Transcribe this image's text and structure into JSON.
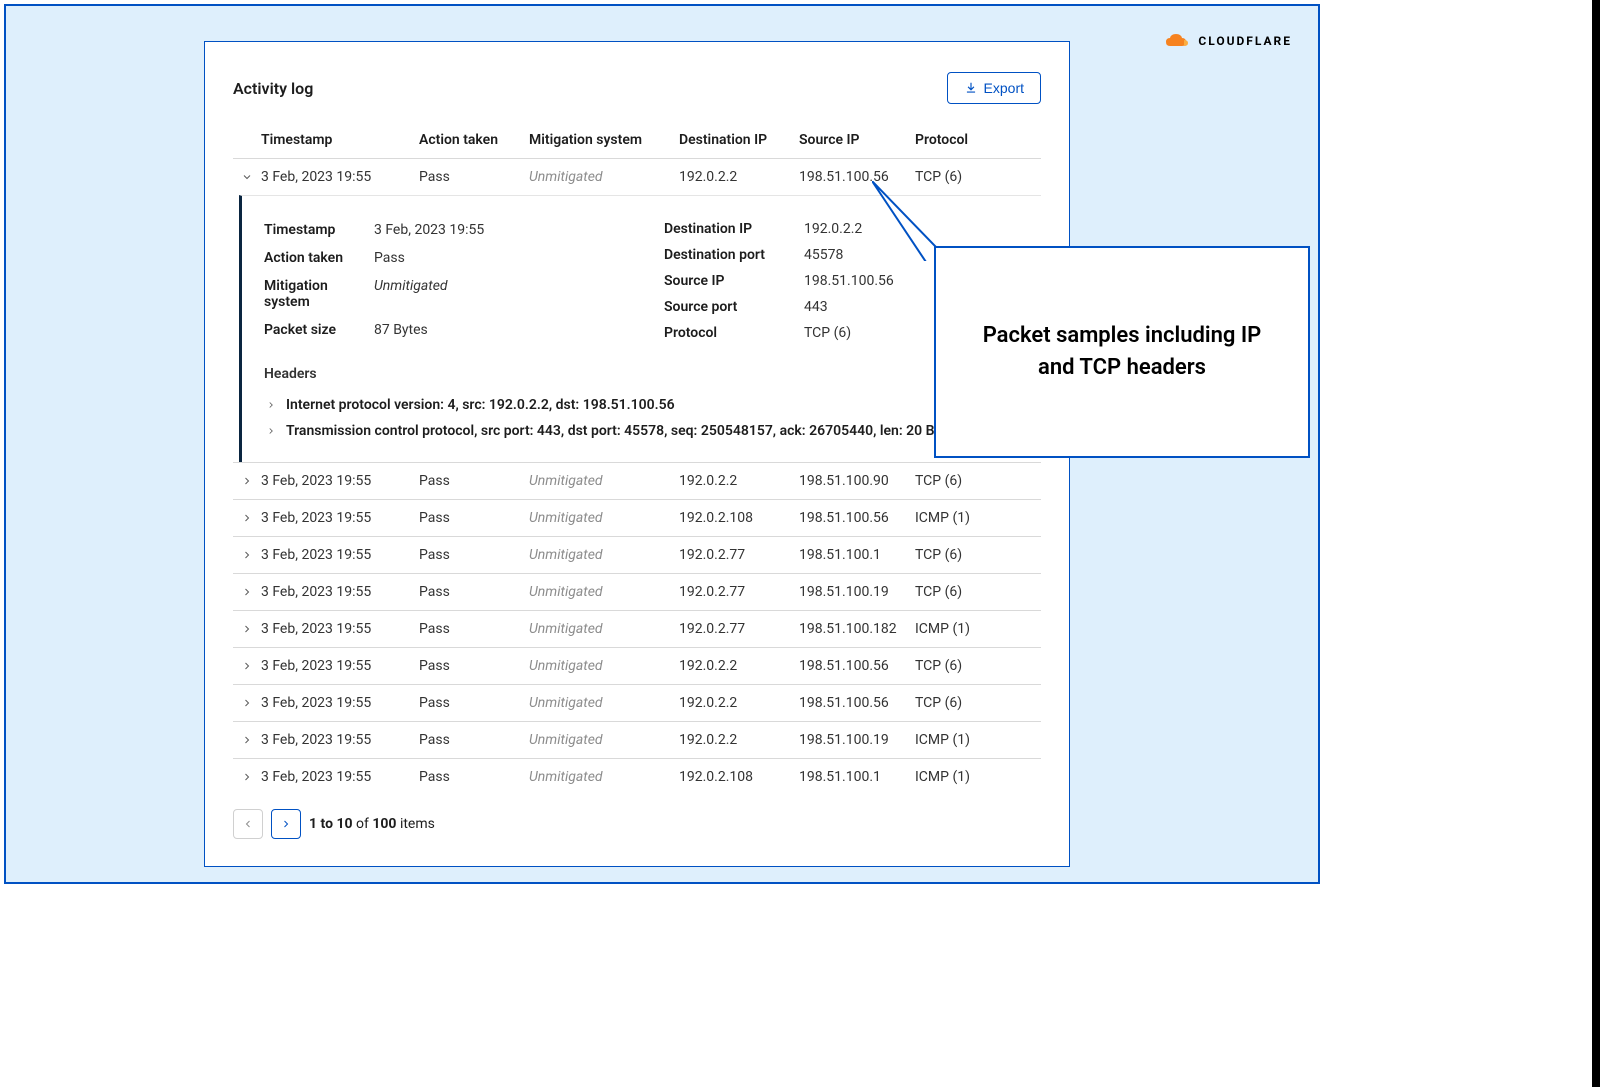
{
  "brand": {
    "name": "CLOUDFLARE"
  },
  "panel": {
    "title": "Activity log",
    "export_label": "Export"
  },
  "columns": {
    "timestamp": "Timestamp",
    "action": "Action taken",
    "mitigation": "Mitigation system",
    "dst_ip": "Destination IP",
    "src_ip": "Source IP",
    "protocol": "Protocol"
  },
  "rows": [
    {
      "timestamp": "3 Feb, 2023 19:55",
      "action": "Pass",
      "mitigation": "Unmitigated",
      "dst_ip": "192.0.2.2",
      "src_ip": "198.51.100.56",
      "protocol": "TCP (6)",
      "expanded": true
    },
    {
      "timestamp": "3 Feb, 2023 19:55",
      "action": "Pass",
      "mitigation": "Unmitigated",
      "dst_ip": "192.0.2.2",
      "src_ip": "198.51.100.90",
      "protocol": "TCP (6)"
    },
    {
      "timestamp": "3 Feb, 2023 19:55",
      "action": "Pass",
      "mitigation": "Unmitigated",
      "dst_ip": "192.0.2.108",
      "src_ip": "198.51.100.56",
      "protocol": "ICMP (1)"
    },
    {
      "timestamp": "3 Feb, 2023 19:55",
      "action": "Pass",
      "mitigation": "Unmitigated",
      "dst_ip": "192.0.2.77",
      "src_ip": "198.51.100.1",
      "protocol": "TCP (6)"
    },
    {
      "timestamp": "3 Feb, 2023 19:55",
      "action": "Pass",
      "mitigation": "Unmitigated",
      "dst_ip": "192.0.2.77",
      "src_ip": "198.51.100.19",
      "protocol": "TCP (6)"
    },
    {
      "timestamp": "3 Feb, 2023 19:55",
      "action": "Pass",
      "mitigation": "Unmitigated",
      "dst_ip": "192.0.2.77",
      "src_ip": "198.51.100.182",
      "protocol": "ICMP (1)"
    },
    {
      "timestamp": "3 Feb, 2023 19:55",
      "action": "Pass",
      "mitigation": "Unmitigated",
      "dst_ip": "192.0.2.2",
      "src_ip": "198.51.100.56",
      "protocol": "TCP (6)"
    },
    {
      "timestamp": "3 Feb, 2023 19:55",
      "action": "Pass",
      "mitigation": "Unmitigated",
      "dst_ip": "192.0.2.2",
      "src_ip": "198.51.100.56",
      "protocol": "TCP (6)"
    },
    {
      "timestamp": "3 Feb, 2023 19:55",
      "action": "Pass",
      "mitigation": "Unmitigated",
      "dst_ip": "192.0.2.2",
      "src_ip": "198.51.100.19",
      "protocol": "ICMP (1)"
    },
    {
      "timestamp": "3 Feb, 2023 19:55",
      "action": "Pass",
      "mitigation": "Unmitigated",
      "dst_ip": "192.0.2.108",
      "src_ip": "198.51.100.1",
      "protocol": "ICMP (1)"
    }
  ],
  "expanded": {
    "labels": {
      "timestamp": "Timestamp",
      "action": "Action taken",
      "mitigation": "Mitigation system",
      "packet_size": "Packet size",
      "dst_ip": "Destination IP",
      "dst_port": "Destination port",
      "src_ip": "Source IP",
      "src_port": "Source port",
      "protocol": "Protocol",
      "headers": "Headers"
    },
    "values": {
      "timestamp": "3 Feb, 2023 19:55",
      "action": "Pass",
      "mitigation": "Unmitigated",
      "packet_size": "87 Bytes",
      "dst_ip": "192.0.2.2",
      "dst_port": "45578",
      "src_ip": "198.51.100.56",
      "src_port": "443",
      "protocol": "TCP (6)"
    },
    "headers": [
      "Internet protocol version: 4, src: 192.0.2.2, dst: 198.51.100.56",
      "Transmission control protocol, src port: 443, dst port: 45578, seq: 250548157, ack: 26705440, len: 20 B"
    ]
  },
  "pagination": {
    "range": "1 to 10",
    "of": "of",
    "total": "100",
    "items_label": "items"
  },
  "callout": {
    "text": "Packet samples including IP and TCP headers"
  }
}
